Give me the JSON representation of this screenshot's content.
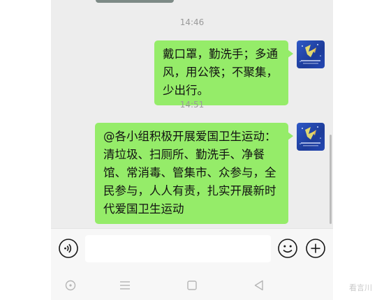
{
  "chat": {
    "messages": [
      {
        "time": "14:46",
        "text": "戴口罩，勤洗手；多通风，用公筷；不聚集，少出行。"
      },
      {
        "time": "14:51",
        "text": "@各小组积极开展爱国卫生运动：清垃圾、扫厕所、勤洗手、净餐馆、常消毒、管集市、众参与，全民参与，人人有责，扎实开展新时代爱国卫生运动"
      }
    ]
  },
  "input_bar": {
    "voice_icon": "voice-icon",
    "emoji_icon": "emoji-icon",
    "more_icon": "plus-circle-icon",
    "value": ""
  },
  "nav_bar": {
    "icons": [
      "circle-dot-icon",
      "menu-lines-icon",
      "square-icon",
      "triangle-back-icon"
    ]
  },
  "colors": {
    "chat_background": "#ededed",
    "sent_bubble": "#95ec69",
    "avatar": "#2447b4"
  },
  "watermark": "看言川"
}
